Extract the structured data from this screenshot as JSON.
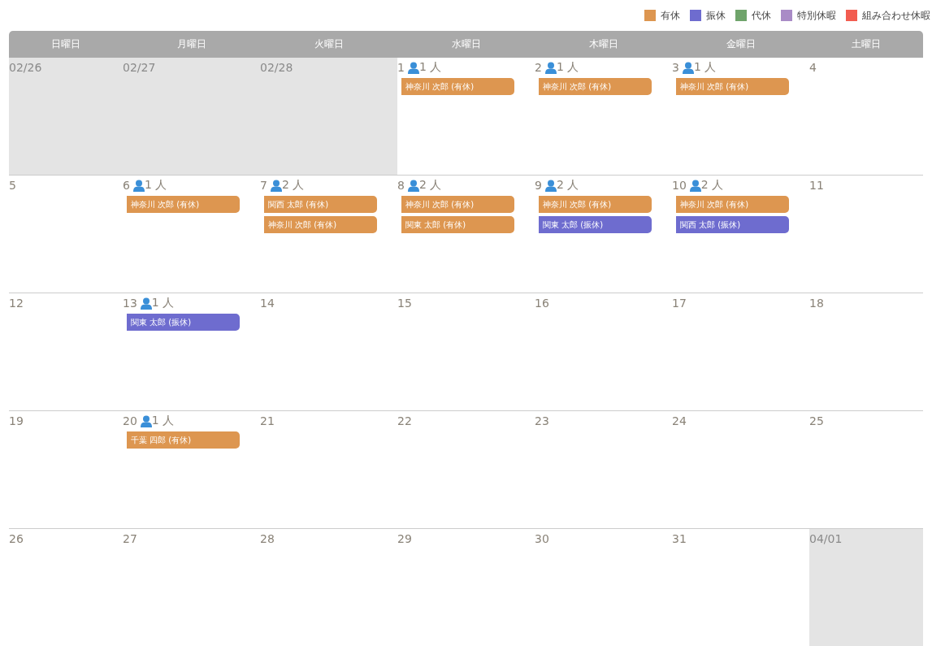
{
  "legend": [
    {
      "label": "有休",
      "color": "#dd9650"
    },
    {
      "label": "振休",
      "color": "#6e6ccf"
    },
    {
      "label": "代休",
      "color": "#6fa46b"
    },
    {
      "label": "特別休暇",
      "color": "#a98bc6"
    },
    {
      "label": "組み合わせ休暇",
      "color": "#f25c50"
    }
  ],
  "weekdays": [
    "日曜日",
    "月曜日",
    "火曜日",
    "水曜日",
    "木曜日",
    "金曜日",
    "土曜日"
  ],
  "weeks": [
    [
      {
        "date": "02/26",
        "outside": true
      },
      {
        "date": "02/27",
        "outside": true
      },
      {
        "date": "02/28",
        "outside": true
      },
      {
        "date": "1",
        "outside": false,
        "count": "1 人",
        "events": [
          {
            "label": "神奈川 次郎 (有休)",
            "color": "#dd9650"
          }
        ]
      },
      {
        "date": "2",
        "outside": false,
        "count": "1 人",
        "events": [
          {
            "label": "神奈川 次郎 (有休)",
            "color": "#dd9650"
          }
        ]
      },
      {
        "date": "3",
        "outside": false,
        "count": "1 人",
        "events": [
          {
            "label": "神奈川 次郎 (有休)",
            "color": "#dd9650"
          }
        ]
      },
      {
        "date": "4",
        "outside": false
      }
    ],
    [
      {
        "date": "5",
        "outside": false
      },
      {
        "date": "6",
        "outside": false,
        "count": "1 人",
        "events": [
          {
            "label": "神奈川 次郎 (有休)",
            "color": "#dd9650"
          }
        ]
      },
      {
        "date": "7",
        "outside": false,
        "count": "2 人",
        "events": [
          {
            "label": "関西 太郎 (有休)",
            "color": "#dd9650"
          },
          {
            "label": "神奈川 次郎 (有休)",
            "color": "#dd9650"
          }
        ]
      },
      {
        "date": "8",
        "outside": false,
        "count": "2 人",
        "events": [
          {
            "label": "神奈川 次郎 (有休)",
            "color": "#dd9650"
          },
          {
            "label": "関東 太郎 (有休)",
            "color": "#dd9650"
          }
        ]
      },
      {
        "date": "9",
        "outside": false,
        "count": "2 人",
        "events": [
          {
            "label": "神奈川 次郎 (有休)",
            "color": "#dd9650"
          },
          {
            "label": "関東 太郎 (振休)",
            "color": "#6e6ccf"
          }
        ]
      },
      {
        "date": "10",
        "outside": false,
        "count": "2 人",
        "events": [
          {
            "label": "神奈川 次郎 (有休)",
            "color": "#dd9650"
          },
          {
            "label": "関西 太郎 (振休)",
            "color": "#6e6ccf"
          }
        ]
      },
      {
        "date": "11",
        "outside": false
      }
    ],
    [
      {
        "date": "12",
        "outside": false
      },
      {
        "date": "13",
        "outside": false,
        "count": "1 人",
        "events": [
          {
            "label": "関東 太郎 (振休)",
            "color": "#6e6ccf"
          }
        ]
      },
      {
        "date": "14",
        "outside": false
      },
      {
        "date": "15",
        "outside": false
      },
      {
        "date": "16",
        "outside": false
      },
      {
        "date": "17",
        "outside": false
      },
      {
        "date": "18",
        "outside": false
      }
    ],
    [
      {
        "date": "19",
        "outside": false
      },
      {
        "date": "20",
        "outside": false,
        "count": "1 人",
        "events": [
          {
            "label": "千葉 四郎 (有休)",
            "color": "#dd9650"
          }
        ]
      },
      {
        "date": "21",
        "outside": false
      },
      {
        "date": "22",
        "outside": false
      },
      {
        "date": "23",
        "outside": false
      },
      {
        "date": "24",
        "outside": false
      },
      {
        "date": "25",
        "outside": false
      }
    ],
    [
      {
        "date": "26",
        "outside": false
      },
      {
        "date": "27",
        "outside": false
      },
      {
        "date": "28",
        "outside": false
      },
      {
        "date": "29",
        "outside": false
      },
      {
        "date": "30",
        "outside": false
      },
      {
        "date": "31",
        "outside": false
      },
      {
        "date": "04/01",
        "outside": true
      }
    ]
  ]
}
